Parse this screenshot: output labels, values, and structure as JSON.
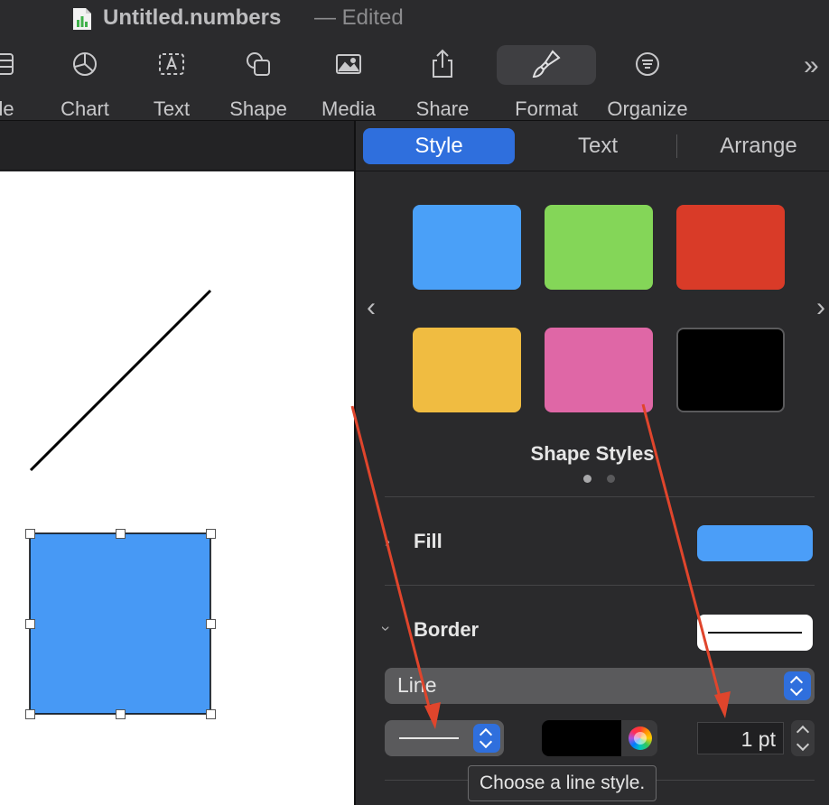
{
  "window": {
    "title": "Untitled.numbers",
    "edited": "— Edited"
  },
  "toolbar": {
    "items": [
      {
        "label": "ble",
        "icon": "table-icon"
      },
      {
        "label": "Chart",
        "icon": "chart-icon"
      },
      {
        "label": "Text",
        "icon": "text-box-icon"
      },
      {
        "label": "Shape",
        "icon": "shape-icon"
      },
      {
        "label": "Media",
        "icon": "media-icon"
      },
      {
        "label": "Share",
        "icon": "share-icon"
      },
      {
        "label": "Format",
        "icon": "paintbrush-icon",
        "active": true
      },
      {
        "label": "Organize",
        "icon": "organize-icon"
      }
    ],
    "overflow": "»"
  },
  "inspector": {
    "tabs": [
      {
        "label": "Style",
        "active": true
      },
      {
        "label": "Text"
      },
      {
        "label": "Arrange"
      }
    ],
    "shape_styles": {
      "caption": "Shape Styles",
      "swatches": [
        "#4aa0f8",
        "#84d658",
        "#d93b28",
        "#f0bc41",
        "#df67a6",
        "#000000"
      ],
      "page": 1,
      "pages": 2
    },
    "fill": {
      "label": "Fill",
      "color": "#4b9ef8"
    },
    "border": {
      "label": "Border",
      "type": "Line",
      "line_style": "solid",
      "color": "#000000",
      "width": "1 pt"
    },
    "tooltip": "Choose a line style."
  },
  "canvas": {
    "selected_shape_fill": "#4799f5"
  },
  "annotation_color": "#e0452c"
}
